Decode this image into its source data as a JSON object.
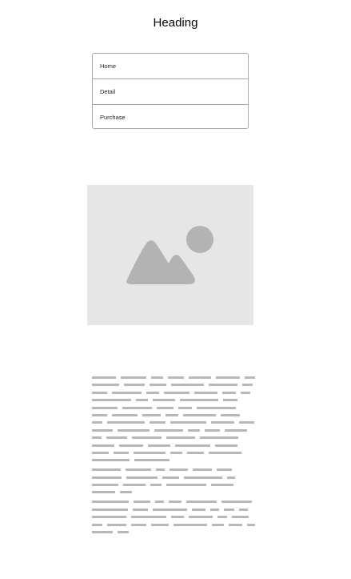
{
  "heading": "Heading",
  "nav": {
    "items": [
      "Home",
      "Detail",
      "Purchase"
    ]
  },
  "image_placeholder": {
    "icon": "image-icon",
    "background_color": "#e6e6e6",
    "icon_color": "#b3b3b3"
  },
  "text_placeholder": {
    "paragraph_line_counts": [
      12,
      4,
      5
    ],
    "placeholder_color": "#b8b8b8"
  }
}
